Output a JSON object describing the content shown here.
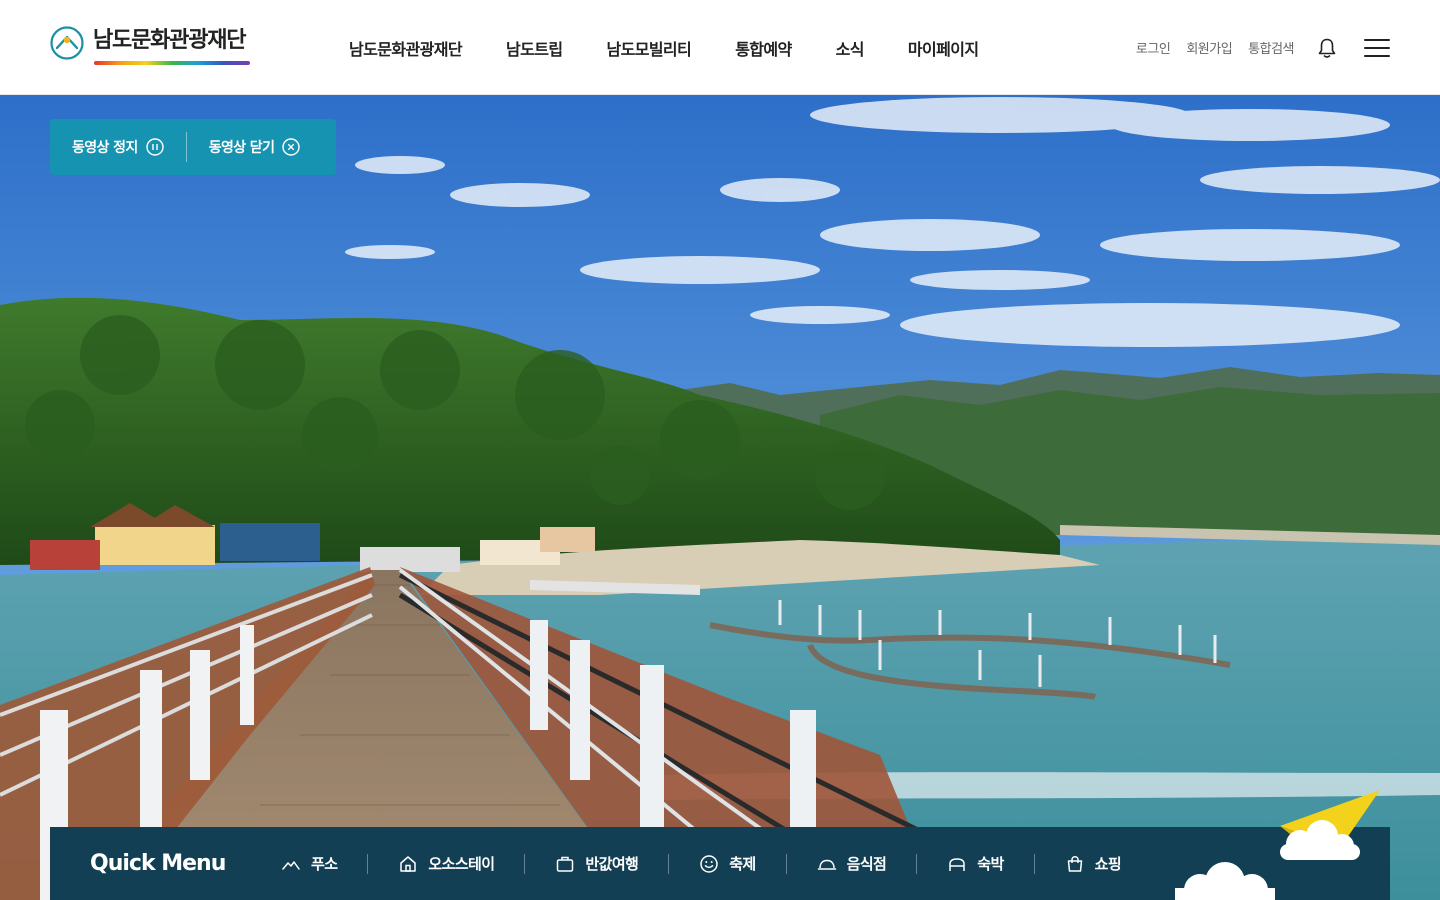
{
  "header": {
    "logo_text": "남도문화관광재단",
    "nav": [
      "남도문화관광재단",
      "남도트립",
      "남도모빌리티",
      "통합예약",
      "소식",
      "마이페이지"
    ],
    "util": {
      "login": "로그인",
      "signup": "회원가입",
      "search": "통합검색"
    }
  },
  "video": {
    "pause_label": "동영상 정지",
    "close_label": "동영상 닫기"
  },
  "quick_menu": {
    "title": "Quick Menu",
    "items": [
      {
        "label": "푸소",
        "icon": "mountain-icon"
      },
      {
        "label": "오소스테이",
        "icon": "home-icon"
      },
      {
        "label": "반값여행",
        "icon": "suitcase-icon"
      },
      {
        "label": "축제",
        "icon": "smile-icon"
      },
      {
        "label": "음식점",
        "icon": "cloche-icon"
      },
      {
        "label": "숙박",
        "icon": "bed-icon"
      },
      {
        "label": "쇼핑",
        "icon": "shopping-bag-icon"
      }
    ]
  },
  "colors": {
    "quick_menu_bg": "#123f53",
    "video_ctrl_bg": "#1496af",
    "accent_yellow": "#f3d21b"
  }
}
